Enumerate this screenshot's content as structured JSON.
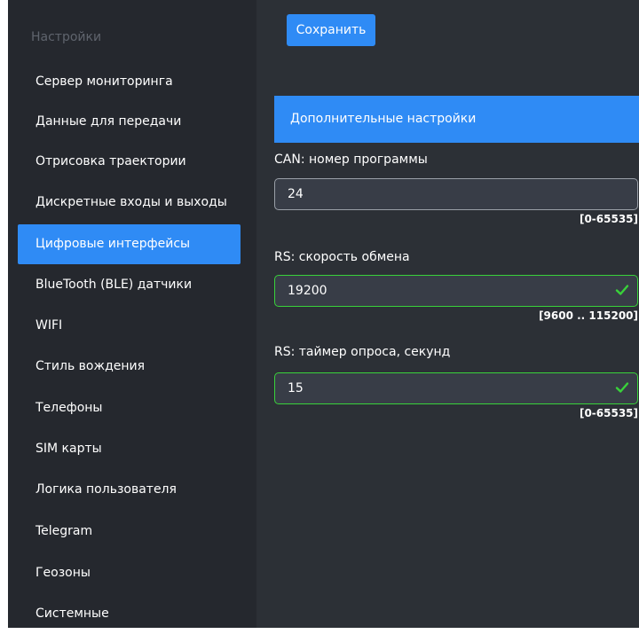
{
  "sidebar": {
    "title": "Настройки",
    "items": [
      {
        "label": "Сервер мониторинга"
      },
      {
        "label": "Данные для передачи"
      },
      {
        "label": "Отрисовка траектории"
      },
      {
        "label": "Дискретные входы и выходы"
      },
      {
        "label": "Цифровые интерфейсы"
      },
      {
        "label": "BlueTooth (BLE) датчики"
      },
      {
        "label": "WIFI"
      },
      {
        "label": "Стиль вождения"
      },
      {
        "label": "Телефоны"
      },
      {
        "label": "SIM карты"
      },
      {
        "label": "Логика пользователя"
      },
      {
        "label": "Telegram"
      },
      {
        "label": "Геозоны"
      },
      {
        "label": "Системные"
      }
    ],
    "active_item": "Цифровые интерфейсы"
  },
  "toolbar": {
    "save_label": "Сохранить"
  },
  "section": {
    "title": "Дополнительные настройки"
  },
  "fields": [
    {
      "label": "CAN: номер программы",
      "value": "24",
      "range": "[0-65535]",
      "valid": false
    },
    {
      "label": "RS: скорость обмена",
      "value": "19200",
      "range": "[9600 .. 115200]",
      "valid": true
    },
    {
      "label": "RS: таймер опроса, секунд",
      "value": "15",
      "range": "[0-65535]",
      "valid": true
    }
  ],
  "icons": {
    "valid": "check-icon"
  },
  "colors": {
    "accent": "#2f8bf5",
    "sidebar_bg": "#25282e",
    "content_bg": "#2c3036",
    "input_bg": "#383d47",
    "valid_border": "#39d23a",
    "check": "#39d23a"
  }
}
